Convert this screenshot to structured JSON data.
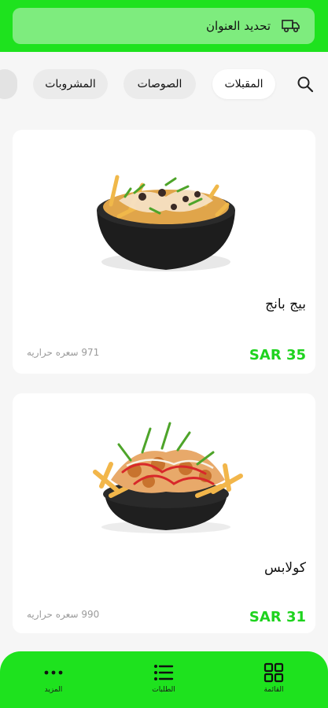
{
  "header": {
    "update_address_label": "تحديد العنوان",
    "icon": "delivery-truck-icon"
  },
  "categories": {
    "items": [
      {
        "label": "المقبلات",
        "active": true
      },
      {
        "label": "الصوصات",
        "active": false
      },
      {
        "label": "المشروبات",
        "active": false
      }
    ],
    "search_icon": "search-icon"
  },
  "products": [
    {
      "name": "بيج بانج",
      "price": "SAR 35",
      "calories": "971 سعره حراريه"
    },
    {
      "name": "كولابس",
      "price": "SAR 31",
      "calories": "990 سعره حراريه"
    }
  ],
  "bottom_nav": {
    "items": [
      {
        "label": "القائمة",
        "icon": "grid-icon"
      },
      {
        "label": "الطلبات",
        "icon": "list-icon"
      },
      {
        "label": "المزيد",
        "icon": "more-dots-icon"
      }
    ]
  },
  "colors": {
    "brand_green": "#1ee21e",
    "price_green": "#1ed31e"
  }
}
